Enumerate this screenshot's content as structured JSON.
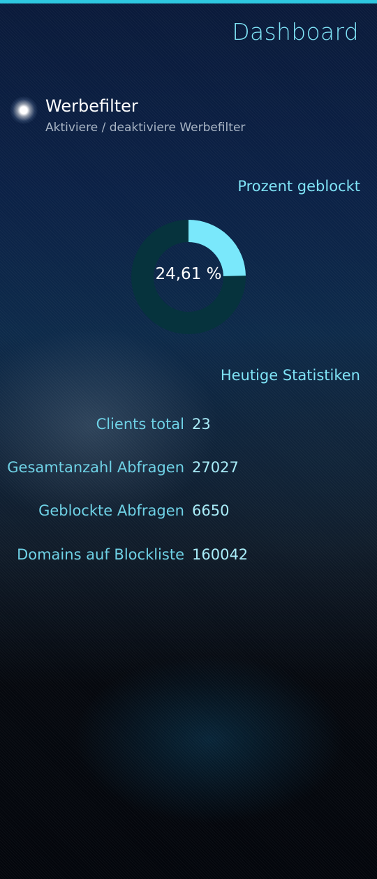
{
  "header": {
    "title": "Dashboard"
  },
  "ad_filter": {
    "label": "Werbefilter",
    "description": "Aktiviere / deaktiviere Werbefilter",
    "enabled": true
  },
  "percent_section": {
    "title": "Prozent geblockt",
    "value_text": "24,61 %",
    "fraction": 0.2461
  },
  "stats_section": {
    "title": "Heutige Statistiken",
    "rows": [
      {
        "label": "Clients total",
        "value": "23"
      },
      {
        "label": "Gesamtanzahl Abfragen",
        "value": "27027"
      },
      {
        "label": "Geblockte Abfragen",
        "value": "6650"
      },
      {
        "label": "Domains auf Blockliste",
        "value": "160042"
      }
    ]
  },
  "colors": {
    "accent": "#7fe3f6",
    "donut_fill": "#7ae8fb",
    "donut_track": "#06333d",
    "top_bar": "#2ec8e0"
  }
}
